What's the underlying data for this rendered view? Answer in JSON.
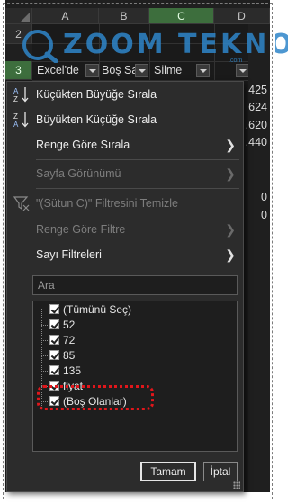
{
  "sheet": {
    "columns": [
      "A",
      "B",
      "C",
      "D"
    ],
    "rows": [
      "2",
      "3"
    ],
    "header_cells": [
      "Excel'de",
      "Boş Satırı",
      "Silme"
    ],
    "right_values": [
      "425",
      "624",
      ".620",
      ".440",
      "0",
      "0"
    ]
  },
  "watermark": {
    "text": "ZOOM TEKNO",
    "sub": ".com"
  },
  "menu": {
    "sort_asc": "Küçükten Büyüğe Sırala",
    "sort_desc": "Büyükten Küçüğe Sırala",
    "sort_by_color": "Renge Göre Sırala",
    "sheet_view": "Sayfa Görünümü",
    "clear_filter": "\"(Sütun C)\" Filtresini Temizle",
    "filter_by_color": "Renge Göre Filtre",
    "number_filters": "Sayı Filtreleri",
    "search_placeholder": "Ara",
    "list": [
      {
        "label": "(Tümünü Seç)",
        "checked": true
      },
      {
        "label": "52",
        "checked": true
      },
      {
        "label": "72",
        "checked": true
      },
      {
        "label": "85",
        "checked": true
      },
      {
        "label": "135",
        "checked": true
      },
      {
        "label": "fiyat",
        "checked": true
      },
      {
        "label": "(Boş Olanlar)",
        "checked": true
      }
    ],
    "ok_label": "Tamam",
    "cancel_label": "İptal"
  },
  "colors": {
    "highlight": "#e0161b",
    "menu_bg": "#2c2c2c",
    "selected_header": "#3d6e3d",
    "watermark": "#2f86c9"
  }
}
